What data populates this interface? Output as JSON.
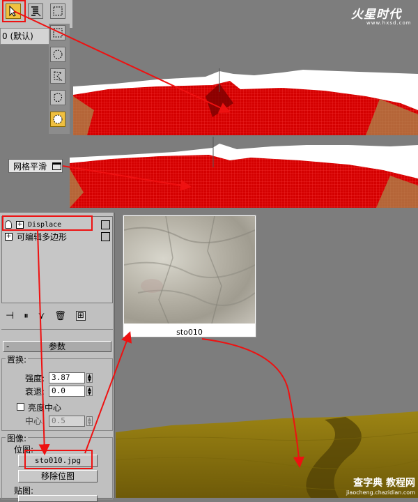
{
  "watermark_top": "火星时代",
  "watermark_top_url": "www.hxsd.com",
  "toolbar": {
    "default_text": "0 (默认)"
  },
  "smooth_label": "网格平滑",
  "stack": {
    "items": [
      {
        "label": "Displace"
      },
      {
        "label": "可编辑多边形"
      }
    ]
  },
  "params": {
    "rollout_title": "参数",
    "displace_group": "置换:",
    "strength_label": "强度:",
    "strength_value": "3.87",
    "decay_label": "衰退:",
    "decay_value": "0.0",
    "luminance_center_label": "亮度中心",
    "center_label": "中心:",
    "center_value": "0.5",
    "image_group": "图像:",
    "bitmap_label": "位图:",
    "bitmap_value": "sto010.jpg",
    "remove_bitmap_label": "移除位图",
    "map_label": "贴图:"
  },
  "texture_caption": "sto010",
  "watermark_bottom": "查字典 教程网",
  "watermark_bottom_url": "jiaocheng.chazidian.com",
  "colors": {
    "accent_red": "#ee1111",
    "mesh_red": "#d40000",
    "terrain_gold": "#8a7310",
    "panel_gray": "#c0c0c0"
  }
}
